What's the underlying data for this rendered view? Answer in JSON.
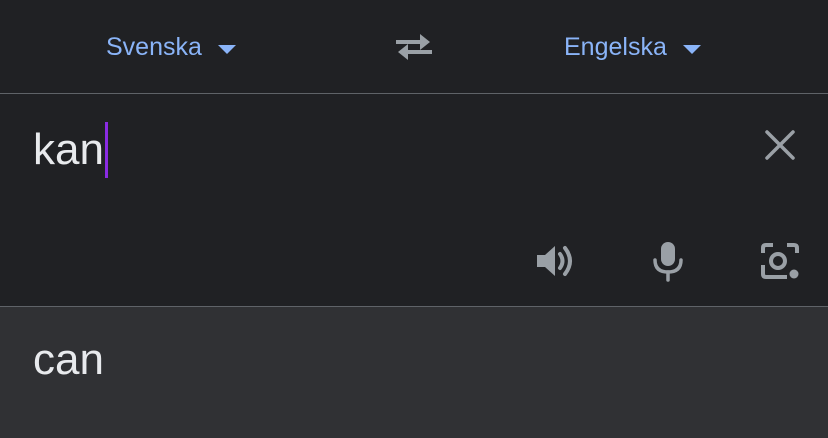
{
  "languages": {
    "source": "Svenska",
    "target": "Engelska"
  },
  "input": {
    "text": "kan"
  },
  "output": {
    "text": "can"
  },
  "icons": {
    "swap": "swap-languages-icon",
    "clear": "close-icon",
    "speaker": "speaker-icon",
    "mic": "microphone-icon",
    "camera": "camera-lens-icon",
    "dropdown": "chevron-down-icon"
  },
  "colors": {
    "background": "#202124",
    "output_background": "#303134",
    "accent": "#8ab4f8",
    "cursor": "#8a2be2",
    "text": "#e8eaed",
    "icon": "#9aa0a6"
  }
}
